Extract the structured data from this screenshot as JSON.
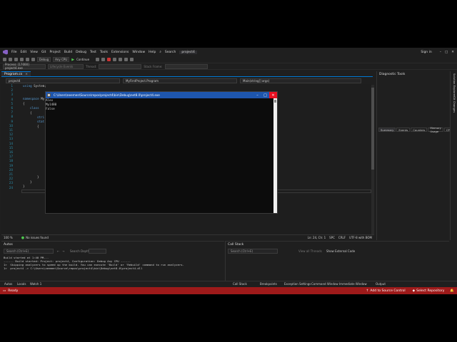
{
  "menu": {
    "items": [
      "File",
      "Edit",
      "View",
      "Git",
      "Project",
      "Build",
      "Debug",
      "Test",
      "Tools",
      "Extensions",
      "Window",
      "Help"
    ],
    "search_label": "Search",
    "solution_name": "project4",
    "sign_in": "Sign in"
  },
  "toolbar": {
    "config": "Debug",
    "platform": "Any CPU",
    "continue": "Continue"
  },
  "debug_bar": {
    "process": "Process: [17000] project4.exe",
    "lifecycle": "Lifecycle Events",
    "thread": "Thread:",
    "stack_frame": "Stack Frame:"
  },
  "doc_tab": {
    "label": "Program.cs"
  },
  "nav": {
    "project": "project4",
    "class": "MyFirstProject.Program",
    "member": "Main(string[] args)"
  },
  "code": {
    "line_numbers": [
      "1",
      "2",
      "3",
      "4",
      "5",
      "6",
      "7",
      "8",
      "9",
      "10",
      "11",
      "12",
      "13",
      "14",
      "15",
      "16",
      "17",
      "18",
      "19",
      "20",
      "21",
      "22",
      "23",
      "24"
    ],
    "using_kw": "using",
    "using_ns": "System;",
    "namespace_kw": "namespace",
    "namespace_name": "My",
    "brace_open": "{",
    "brace_close": "}",
    "class_prefix": "class",
    "string_prefix": "stri",
    "static_prefix": "stat"
  },
  "console": {
    "title": "C:\\Users\\neemen\\Source\\repos\\project4\\bin\\Debug\\net8.0\\project4.exe",
    "output": [
      "Alex",
      "My1480",
      "False"
    ]
  },
  "editor_status": {
    "zoom": "100 %",
    "issues": "No issues found",
    "position": "Ln: 24, Ch: 1",
    "spc": "SPC",
    "crlf": "CRLF",
    "encoding": "UTF-8 with BOM"
  },
  "diagnostic": {
    "title": "Diagnostic Tools",
    "tabs": [
      "Summary",
      "Events",
      "Counters",
      "Memory Usage",
      "CPU"
    ]
  },
  "side_strip": {
    "items": [
      "Solution Explorer",
      "Git Changes"
    ]
  },
  "autos": {
    "title": "Autos",
    "search_placeholder": "Search (Ctrl+E)",
    "search_depth": "Search Depth:",
    "output_lines": [
      "Build started at 1:40 PM...",
      "------ Build started: Project: project4, Configuration: Debug Any CPU ------",
      "1>  Skipping analyzers to speed up the build. You can execute 'Build' or 'Rebuild' command to run analyzers.",
      "1>  project4 -> C:\\Users\\neemen\\Source\\repos\\project4\\bin\\Debug\\net8.0\\project4.dll"
    ]
  },
  "callstack": {
    "title": "Call Stack",
    "search_placeholder": "Search (Ctrl+E)",
    "view_threads": "View all Threads",
    "show_external": "Show External Code"
  },
  "bottom_tabs": {
    "left": [
      "Autos",
      "Locals",
      "Watch 1"
    ],
    "right": [
      "Call Stack",
      "Breakpoints",
      "Exception Settings",
      "Command Window",
      "Immediate Window",
      "Output"
    ]
  },
  "status": {
    "ready": "Ready",
    "source_control": "Add to Source Control",
    "repository": "Select Repository"
  },
  "colors": {
    "status_bar": "#9e1a1a",
    "console_title": "#1e56ad",
    "accent": "#0078d4"
  }
}
